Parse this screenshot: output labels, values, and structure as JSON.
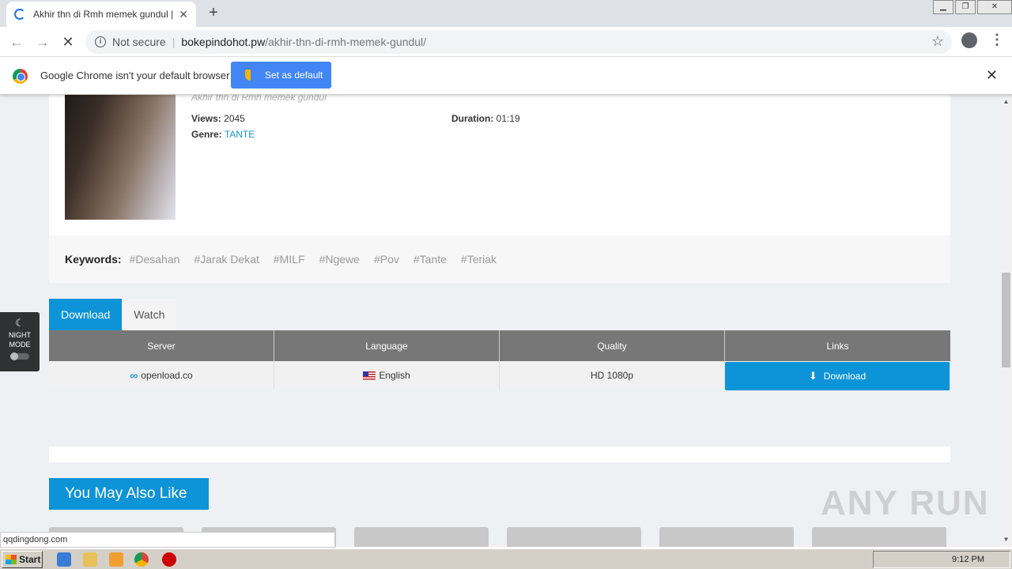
{
  "browser": {
    "tab_title": "Akhir thn di Rmh memek gundul | Vid",
    "security_label": "Not secure",
    "url_host": "bokepindohot.pw",
    "url_path": "/akhir-thn-di-rmh-memek-gundul/",
    "infobar_message": "Google Chrome isn't your default browser",
    "set_default_label": "Set as default"
  },
  "video": {
    "subtitle": "Akhir thn di Rmh memek gundul",
    "views_label": "Views:",
    "views": "2045",
    "duration_label": "Duration:",
    "duration": "01:19",
    "genre_label": "Genre:",
    "genre": "TANTE"
  },
  "keywords": {
    "label": "Keywords:",
    "items": [
      "#Desahan",
      "#Jarak Dekat",
      "#MILF",
      "#Ngewe",
      "#Pov",
      "#Tante",
      "#Teriak"
    ]
  },
  "tabs": {
    "download": "Download",
    "watch": "Watch"
  },
  "table": {
    "headers": [
      "Server",
      "Language",
      "Quality",
      "Links"
    ],
    "row": {
      "server": "openload.co",
      "language": "English",
      "quality": "HD 1080p",
      "link": "Download"
    }
  },
  "night_mode": {
    "line1": "NIGHT",
    "line2": "MODE"
  },
  "section_title": "You May Also Like",
  "status_url": "qqdingdong.com",
  "watermark": "ANY RUN",
  "taskbar": {
    "start": "Start",
    "time": "9:12 PM"
  }
}
